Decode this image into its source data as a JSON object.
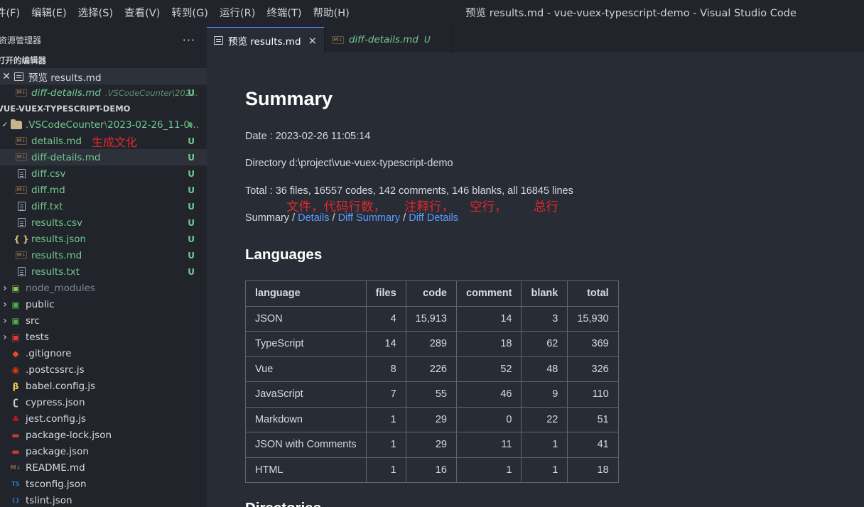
{
  "menu": [
    "件(F)",
    "编辑(E)",
    "选择(S)",
    "查看(V)",
    "转到(G)",
    "运行(R)",
    "终端(T)",
    "帮助(H)"
  ],
  "window_title": "预览 results.md - vue-vuex-typescript-demo - Visual Studio Code",
  "sidebar": {
    "title": "资源管理器",
    "more": "···",
    "open_editors_title": "打开的编辑器",
    "open_editors": [
      {
        "label": "预览 results.md"
      },
      {
        "label": "diff-details.md",
        "hint": ".VSCodeCounter\\202...",
        "badge": "U"
      }
    ],
    "project_title": "VUE-VUEX-TYPESCRIPT-DEMO",
    "folder": {
      "name": ".VSCodeCounter",
      "sep": "\\",
      "sub": "2023-02-26_11-0..."
    },
    "annotation": "生成文化",
    "counter_files": [
      {
        "name": "details.md",
        "icon": "md",
        "badge": "U"
      },
      {
        "name": "diff-details.md",
        "icon": "md",
        "badge": "U"
      },
      {
        "name": "diff.csv",
        "icon": "file",
        "badge": "U"
      },
      {
        "name": "diff.md",
        "icon": "md",
        "badge": "U"
      },
      {
        "name": "diff.txt",
        "icon": "file",
        "badge": "U"
      },
      {
        "name": "results.csv",
        "icon": "file",
        "badge": "U"
      },
      {
        "name": "results.json",
        "icon": "json",
        "badge": "U"
      },
      {
        "name": "results.md",
        "icon": "md",
        "badge": "U"
      },
      {
        "name": "results.txt",
        "icon": "file",
        "badge": "U"
      }
    ],
    "root_items": [
      {
        "name": "node_modules",
        "folder": true
      },
      {
        "name": "public",
        "folder": true
      },
      {
        "name": "src",
        "folder": true
      },
      {
        "name": "tests",
        "folder": true
      },
      {
        "name": ".gitignore"
      },
      {
        "name": ".postcssrc.js"
      },
      {
        "name": "babel.config.js"
      },
      {
        "name": "cypress.json"
      },
      {
        "name": "jest.config.js"
      },
      {
        "name": "package-lock.json"
      },
      {
        "name": "package.json"
      },
      {
        "name": "README.md"
      },
      {
        "name": "tsconfig.json"
      },
      {
        "name": "tslint.json"
      }
    ],
    "icon_colors": {
      "node_modules": "#8bc34a",
      "public": "#4caf50",
      "src": "#4caf50",
      "tests": "#e53935",
      ".gitignore": "#e44d26",
      ".postcssrc.js": "#dd3a0a",
      "babel.config.js": "#f5da55",
      "cypress.json": "#cfd2d8",
      "jest.config.js": "#c21325",
      "package-lock.json": "#cb3837",
      "package.json": "#cb3837",
      "README.md": "#8a6a4a",
      "tsconfig.json": "#3178c6",
      "tslint.json": "#3178c6"
    }
  },
  "tabs": [
    {
      "label": "预览 results.md",
      "close": "×"
    },
    {
      "label": "diff-details.md",
      "badge": "U"
    }
  ],
  "preview": {
    "title": "Summary",
    "date": "Date : 2023-02-26 11:05:14",
    "directory": "Directory d:\\project\\vue-vuex-typescript-demo",
    "total": "Total : 36 files, 16557 codes, 142 comments, 146 blanks, all 16845 lines",
    "annotations": [
      "文件，代码行数，",
      "注释行，",
      "空行，",
      "总行"
    ],
    "nav": {
      "current": "Summary",
      "sep": " / ",
      "links": [
        "Details",
        "Diff Summary",
        "Diff Details"
      ]
    },
    "languages_title": "Languages",
    "table": {
      "headers": [
        "language",
        "files",
        "code",
        "comment",
        "blank",
        "total"
      ],
      "rows": [
        [
          "JSON",
          "4",
          "15,913",
          "14",
          "3",
          "15,930"
        ],
        [
          "TypeScript",
          "14",
          "289",
          "18",
          "62",
          "369"
        ],
        [
          "Vue",
          "8",
          "226",
          "52",
          "48",
          "326"
        ],
        [
          "JavaScript",
          "7",
          "55",
          "46",
          "9",
          "110"
        ],
        [
          "Markdown",
          "1",
          "29",
          "0",
          "22",
          "51"
        ],
        [
          "JSON with Comments",
          "1",
          "29",
          "11",
          "1",
          "41"
        ],
        [
          "HTML",
          "1",
          "16",
          "1",
          "1",
          "18"
        ]
      ]
    },
    "directories_title": "Directories"
  }
}
